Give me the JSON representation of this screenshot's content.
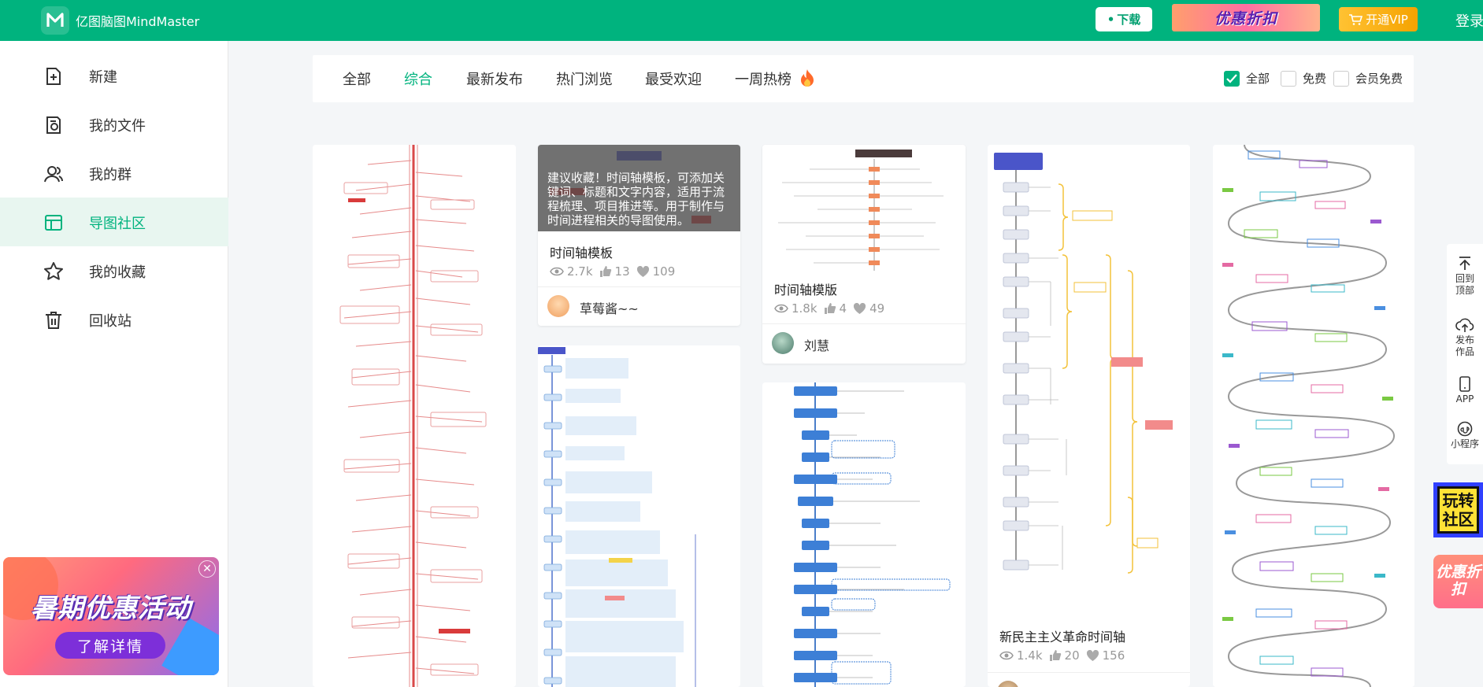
{
  "header": {
    "app_name": "亿图脑图MindMaster",
    "download_label": "下载",
    "promo_label": "优惠折扣",
    "vip_label": "开通VIP",
    "login_label": "登录"
  },
  "sidebar": {
    "items": [
      {
        "label": "新建",
        "icon": "new-file-icon"
      },
      {
        "label": "我的文件",
        "icon": "my-files-icon"
      },
      {
        "label": "我的群",
        "icon": "group-icon"
      },
      {
        "label": "导图社区",
        "icon": "community-icon"
      },
      {
        "label": "我的收藏",
        "icon": "star-icon"
      },
      {
        "label": "回收站",
        "icon": "trash-icon"
      }
    ],
    "active_index": 3,
    "ad": {
      "title": "暑期优惠活动",
      "button": "了解详情"
    }
  },
  "tabs": {
    "items": [
      "全部",
      "综合",
      "最新发布",
      "热门浏览",
      "最受欢迎",
      "一周热榜"
    ],
    "active_index": 1
  },
  "filters": [
    {
      "label": "全部",
      "checked": true
    },
    {
      "label": "免费",
      "checked": false
    },
    {
      "label": "会员免费",
      "checked": false
    }
  ],
  "cards": [
    {
      "title": "时间轴模板",
      "overlay": "建议收藏！时间轴模板，可添加关键词、标题和文字内容，适用于流程梳理、项目推进等。用于制作与时间进程相关的导图使用。",
      "views": "2.7k",
      "likes": "13",
      "favorites": "109",
      "author": "草莓酱~~"
    },
    {
      "title": "时间轴模版",
      "views": "1.8k",
      "likes": "4",
      "favorites": "49",
      "author": "刘慧"
    },
    {
      "title": "新民主主义革命时间轴",
      "views": "1.4k",
      "likes": "20",
      "favorites": "156"
    }
  ],
  "right_toolbar": {
    "back_to_top": "回到顶部",
    "publish": "发布作品",
    "app": "APP",
    "mini_program": "小程序"
  },
  "badges": {
    "play": "玩转社区",
    "sale": "优惠折扣"
  },
  "colors": {
    "brand": "#00b37e",
    "vip": "#f5a300",
    "accent_red": "#e05a5a"
  }
}
